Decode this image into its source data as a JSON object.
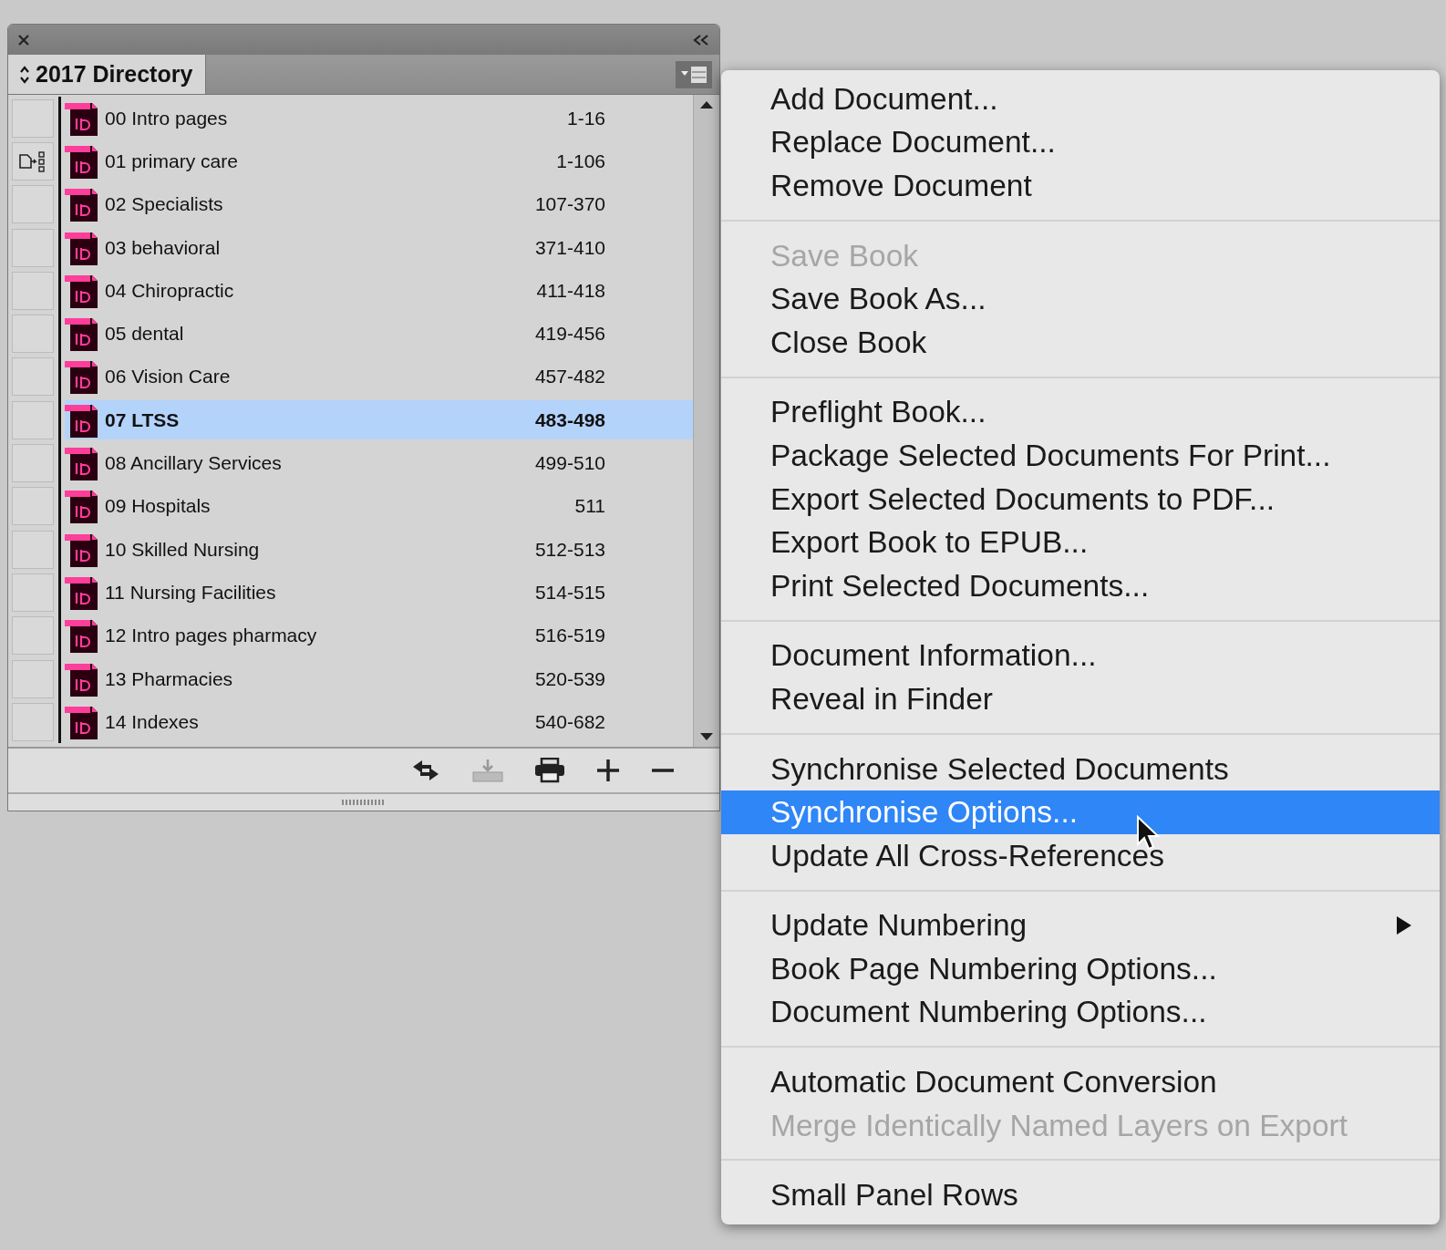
{
  "panel": {
    "title": "2017 Directory",
    "documents": [
      {
        "name": "00 Intro pages",
        "pages": "1-16",
        "selected": false,
        "style_source": false
      },
      {
        "name": "01 primary care",
        "pages": "1-106",
        "selected": false,
        "style_source": true
      },
      {
        "name": "02 Specialists",
        "pages": "107-370",
        "selected": false,
        "style_source": false
      },
      {
        "name": "03 behavioral",
        "pages": "371-410",
        "selected": false,
        "style_source": false
      },
      {
        "name": "04 Chiropractic",
        "pages": "411-418",
        "selected": false,
        "style_source": false
      },
      {
        "name": "05 dental",
        "pages": "419-456",
        "selected": false,
        "style_source": false
      },
      {
        "name": "06 Vision Care",
        "pages": "457-482",
        "selected": false,
        "style_source": false
      },
      {
        "name": "07 LTSS",
        "pages": "483-498",
        "selected": true,
        "style_source": false
      },
      {
        "name": "08 Ancillary Services",
        "pages": "499-510",
        "selected": false,
        "style_source": false
      },
      {
        "name": "09 Hospitals",
        "pages": "511",
        "selected": false,
        "style_source": false
      },
      {
        "name": "10 Skilled Nursing",
        "pages": "512-513",
        "selected": false,
        "style_source": false
      },
      {
        "name": "11 Nursing Facilities",
        "pages": "514-515",
        "selected": false,
        "style_source": false
      },
      {
        "name": "12 Intro pages pharmacy",
        "pages": "516-519",
        "selected": false,
        "style_source": false
      },
      {
        "name": "13 Pharmacies",
        "pages": "520-539",
        "selected": false,
        "style_source": false
      },
      {
        "name": "14 Indexes",
        "pages": "540-682",
        "selected": false,
        "style_source": false
      }
    ]
  },
  "menu": {
    "groups": [
      [
        {
          "label": "Add Document...",
          "disabled": false,
          "selected": false,
          "submenu": false
        },
        {
          "label": "Replace Document...",
          "disabled": false,
          "selected": false,
          "submenu": false
        },
        {
          "label": "Remove Document",
          "disabled": false,
          "selected": false,
          "submenu": false
        }
      ],
      [
        {
          "label": "Save Book",
          "disabled": true,
          "selected": false,
          "submenu": false
        },
        {
          "label": "Save Book As...",
          "disabled": false,
          "selected": false,
          "submenu": false
        },
        {
          "label": "Close Book",
          "disabled": false,
          "selected": false,
          "submenu": false
        }
      ],
      [
        {
          "label": "Preflight Book...",
          "disabled": false,
          "selected": false,
          "submenu": false
        },
        {
          "label": "Package Selected Documents For Print...",
          "disabled": false,
          "selected": false,
          "submenu": false
        },
        {
          "label": "Export Selected Documents to PDF...",
          "disabled": false,
          "selected": false,
          "submenu": false
        },
        {
          "label": "Export Book to EPUB...",
          "disabled": false,
          "selected": false,
          "submenu": false
        },
        {
          "label": "Print Selected Documents...",
          "disabled": false,
          "selected": false,
          "submenu": false
        }
      ],
      [
        {
          "label": "Document Information...",
          "disabled": false,
          "selected": false,
          "submenu": false
        },
        {
          "label": "Reveal in Finder",
          "disabled": false,
          "selected": false,
          "submenu": false
        }
      ],
      [
        {
          "label": "Synchronise Selected Documents",
          "disabled": false,
          "selected": false,
          "submenu": false
        },
        {
          "label": "Synchronise Options...",
          "disabled": false,
          "selected": true,
          "submenu": false
        },
        {
          "label": "Update All Cross-References",
          "disabled": false,
          "selected": false,
          "submenu": false
        }
      ],
      [
        {
          "label": "Update Numbering",
          "disabled": false,
          "selected": false,
          "submenu": true
        },
        {
          "label": "Book Page Numbering Options...",
          "disabled": false,
          "selected": false,
          "submenu": false
        },
        {
          "label": "Document Numbering Options...",
          "disabled": false,
          "selected": false,
          "submenu": false
        }
      ],
      [
        {
          "label": "Automatic Document Conversion",
          "disabled": false,
          "selected": false,
          "submenu": false
        },
        {
          "label": "Merge Identically Named Layers on Export",
          "disabled": true,
          "selected": false,
          "submenu": false
        }
      ],
      [
        {
          "label": "Small Panel Rows",
          "disabled": false,
          "selected": false,
          "submenu": false
        }
      ]
    ]
  }
}
